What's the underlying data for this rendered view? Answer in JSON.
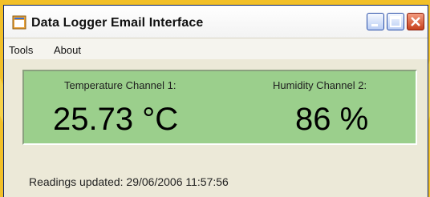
{
  "window": {
    "title": "Data Logger Email Interface"
  },
  "menu": {
    "items": [
      "Tools",
      "About"
    ]
  },
  "channels": [
    {
      "label": "Temperature Channel 1:",
      "value": "25.73 °C"
    },
    {
      "label": "Humidity Channel 2:",
      "value": "86 %"
    }
  ],
  "status": {
    "text": "Readings updated: 29/06/2006 11:57:56"
  },
  "colors": {
    "reading_panel": "#9bcf8c",
    "window_bg": "#ece9d8",
    "close_button": "#c7411d",
    "background": "#f2c028"
  },
  "icons": {
    "app": "app-window-icon",
    "minimize": "minimize-icon",
    "maximize": "maximize-icon",
    "close": "close-icon"
  }
}
